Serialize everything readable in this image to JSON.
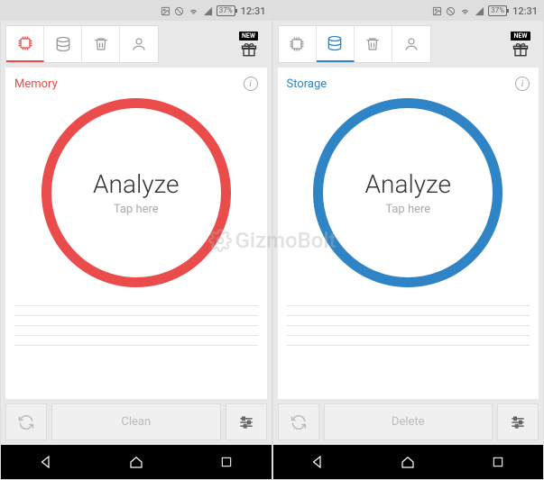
{
  "statusbar": {
    "battery": "37%",
    "time": "12:31"
  },
  "screens": [
    {
      "id": "memory",
      "accent": "#ea4b4b",
      "active_tab_index": 0,
      "section_title": "Memory",
      "analyze_label": "Analyze",
      "analyze_sub": "Tap here",
      "action_label": "Clean",
      "new_badge": "NEW"
    },
    {
      "id": "storage",
      "accent": "#2e84c5",
      "active_tab_index": 1,
      "section_title": "Storage",
      "analyze_label": "Analyze",
      "analyze_sub": "Tap here",
      "action_label": "Delete",
      "new_badge": "NEW"
    }
  ],
  "tabs": [
    {
      "name": "tab-memory",
      "icon": "chip-icon"
    },
    {
      "name": "tab-storage",
      "icon": "disks-icon"
    },
    {
      "name": "tab-trash",
      "icon": "trash-icon"
    },
    {
      "name": "tab-profile",
      "icon": "person-icon"
    }
  ],
  "watermark": "GizmoBolt"
}
